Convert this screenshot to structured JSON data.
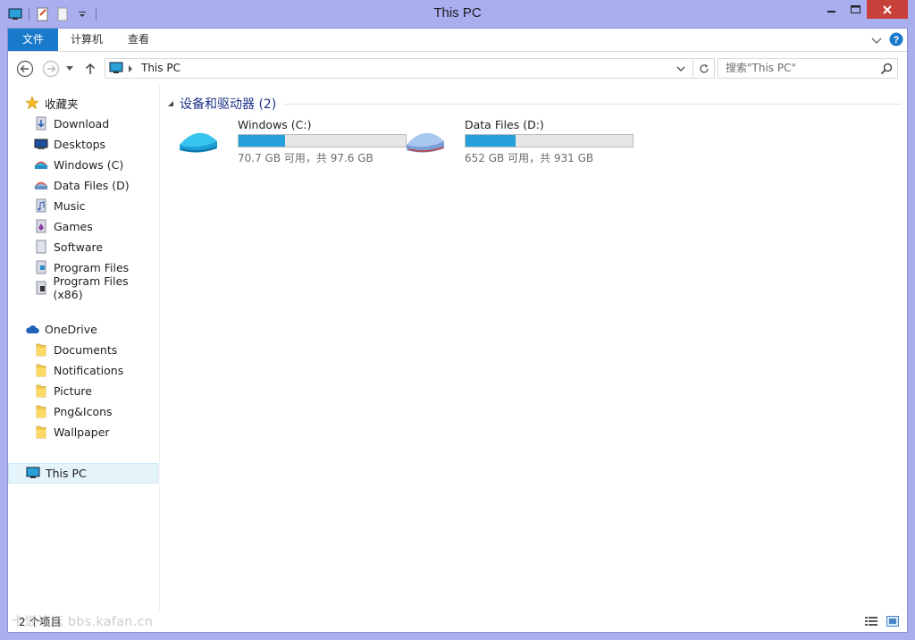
{
  "window": {
    "title": "This PC"
  },
  "ribbon": {
    "tabs": [
      "文件",
      "计算机",
      "查看"
    ]
  },
  "address": {
    "crumb": "This PC"
  },
  "search": {
    "placeholder": "搜索\"This PC\""
  },
  "sidebar": {
    "favorites_label": "收藏夹",
    "favorites": [
      {
        "label": "Download",
        "icon": "download-folder-icon"
      },
      {
        "label": "Desktops",
        "icon": "desktop-icon"
      },
      {
        "label": "Windows (C)",
        "icon": "drive-icon"
      },
      {
        "label": "Data Files (D)",
        "icon": "drive-icon"
      },
      {
        "label": "Music",
        "icon": "music-folder-icon"
      },
      {
        "label": "Games",
        "icon": "games-folder-icon"
      },
      {
        "label": "Software",
        "icon": "folder-icon"
      },
      {
        "label": "Program Files",
        "icon": "folder-icon"
      },
      {
        "label": "Program Files (x86)",
        "icon": "folder-icon"
      }
    ],
    "onedrive_label": "OneDrive",
    "onedrive": [
      {
        "label": "Documents"
      },
      {
        "label": "Notifications"
      },
      {
        "label": "Picture"
      },
      {
        "label": "Png&Icons"
      },
      {
        "label": "Wallpaper"
      }
    ],
    "thispc_label": "This PC"
  },
  "content": {
    "group_label": "设备和驱动器 (2)",
    "drives": [
      {
        "name": "Windows (C:)",
        "info": "70.7 GB 可用，共 97.6 GB",
        "used_fraction": 0.276,
        "color": "#2ab6e8"
      },
      {
        "name": "Data Files (D:)",
        "info": "652 GB 可用，共 931 GB",
        "used_fraction": 0.3,
        "color": "#8fb8e8"
      }
    ]
  },
  "status": {
    "count": "2 个项目",
    "watermark": "卡饭论坛 bbs.kafan.cn"
  },
  "colors": {
    "accent": "#1979ca",
    "progress": "#26a0da",
    "frame": "#a9aeef"
  }
}
